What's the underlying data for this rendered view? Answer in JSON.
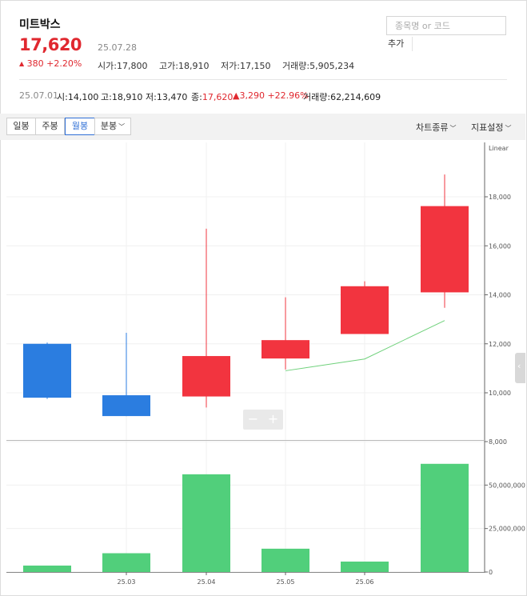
{
  "stock": {
    "name": "미트박스",
    "price": "17,620",
    "date": "25.07.28",
    "change": "380",
    "change_pct": "+2.20%",
    "open_label": "시가",
    "open": "17,800",
    "high_label": "고가",
    "high": "18,910",
    "low_label": "저가",
    "low": "17,150",
    "volume_label": "거래량",
    "volume": "5,905,234"
  },
  "search": {
    "placeholder": "종목명 or 코드",
    "add_label": "추가"
  },
  "period": {
    "date": "25.07.01",
    "open_label": "시",
    "open": "14,100",
    "high_label": "고",
    "high": "18,910",
    "low_label": "저",
    "low": "13,470",
    "close_label": "종",
    "close": "17,620",
    "change": "3,290",
    "change_pct": "+22.96%",
    "volume_label": "거래량",
    "volume": "62,214,609"
  },
  "toolbar": {
    "tabs": [
      "일봉",
      "주봉",
      "월봉",
      "분봉"
    ],
    "active_tab": "월봉",
    "chart_type_label": "차트종류",
    "indicator_label": "지표설정"
  },
  "colors": {
    "up": "#f2343f",
    "down": "#2b7de0",
    "volume": "#51cf7b",
    "ma": "#6fd17b",
    "price_red": "#e0282f"
  },
  "chart_data": {
    "type": "candlestick",
    "scale_label": "Linear",
    "y_ticks": [
      "18,000",
      "16,000",
      "14,000",
      "12,000",
      "10,000"
    ],
    "y_tick_values": [
      18000,
      16000,
      14000,
      12000,
      10000
    ],
    "price_range": [
      8800,
      19500
    ],
    "x_ticks": [
      "25.03",
      "25.04",
      "25.05",
      "25.06"
    ],
    "candles": [
      {
        "open": 12000,
        "high": 12050,
        "low": 9750,
        "close": 9800
      },
      {
        "open": 9900,
        "high": 12450,
        "low": 9050,
        "close": 9050
      },
      {
        "open": 9850,
        "high": 16700,
        "low": 9400,
        "close": 11500
      },
      {
        "open": 11400,
        "high": 13900,
        "low": 10950,
        "close": 12150
      },
      {
        "open": 12400,
        "high": 14550,
        "low": 12400,
        "close": 14350
      },
      {
        "open": 14100,
        "high": 18910,
        "low": 13470,
        "close": 17620
      }
    ],
    "ma_line": [
      null,
      null,
      null,
      10900,
      11380,
      12950
    ],
    "volume_ticks": [
      "8,000",
      "50,000,000",
      "25,000,000",
      "0"
    ],
    "volume_tick_values": [
      75000000,
      50000000,
      25000000,
      0
    ],
    "volume_max": 75000000,
    "volumes": [
      3700000,
      10800000,
      56200000,
      13400000,
      6000000,
      62214609
    ]
  }
}
